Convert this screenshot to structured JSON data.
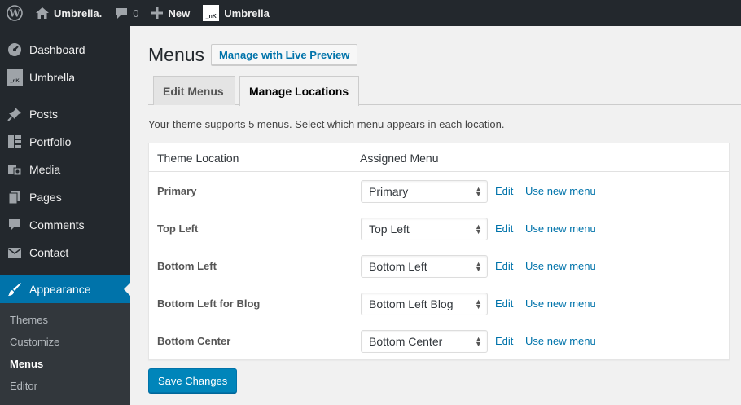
{
  "adminbar": {
    "site_name": "Umbrella.",
    "comments_count": "0",
    "new_label": "New",
    "site2_logo": "_nK",
    "site2_name": "Umbrella"
  },
  "sidebar": {
    "items": [
      {
        "label": "Dashboard",
        "icon": "dashboard-icon"
      },
      {
        "label": "Umbrella",
        "icon": "umbrella-logo-icon",
        "logo": "_nK"
      },
      {
        "label": "Posts",
        "icon": "pin-icon"
      },
      {
        "label": "Portfolio",
        "icon": "portfolio-icon"
      },
      {
        "label": "Media",
        "icon": "media-icon"
      },
      {
        "label": "Pages",
        "icon": "pages-icon"
      },
      {
        "label": "Comments",
        "icon": "comment-icon"
      },
      {
        "label": "Contact",
        "icon": "mail-icon"
      },
      {
        "label": "Appearance",
        "icon": "brush-icon"
      }
    ],
    "submenu": [
      "Themes",
      "Customize",
      "Menus",
      "Editor"
    ]
  },
  "main": {
    "title": "Menus",
    "live_preview_button": "Manage with Live Preview",
    "tabs": [
      {
        "label": "Edit Menus",
        "active": false
      },
      {
        "label": "Manage Locations",
        "active": true
      }
    ],
    "intro": "Your theme supports 5 menus. Select which menu appears in each location.",
    "table": {
      "headers": [
        "Theme Location",
        "Assigned Menu"
      ],
      "rows": [
        {
          "location": "Primary",
          "menu": "Primary",
          "edit": "Edit",
          "use_new": "Use new menu"
        },
        {
          "location": "Top Left",
          "menu": "Top Left",
          "edit": "Edit",
          "use_new": "Use new menu"
        },
        {
          "location": "Bottom Left",
          "menu": "Bottom Left",
          "edit": "Edit",
          "use_new": "Use new menu"
        },
        {
          "location": "Bottom Left for Blog",
          "menu": "Bottom Left Blog",
          "edit": "Edit",
          "use_new": "Use new menu"
        },
        {
          "location": "Bottom Center",
          "menu": "Bottom Center",
          "edit": "Edit",
          "use_new": "Use new menu"
        }
      ]
    },
    "save_button": "Save Changes"
  },
  "colors": {
    "adminbar_bg": "#23282d",
    "accent": "#0073aa",
    "primary_button": "#0085ba"
  }
}
